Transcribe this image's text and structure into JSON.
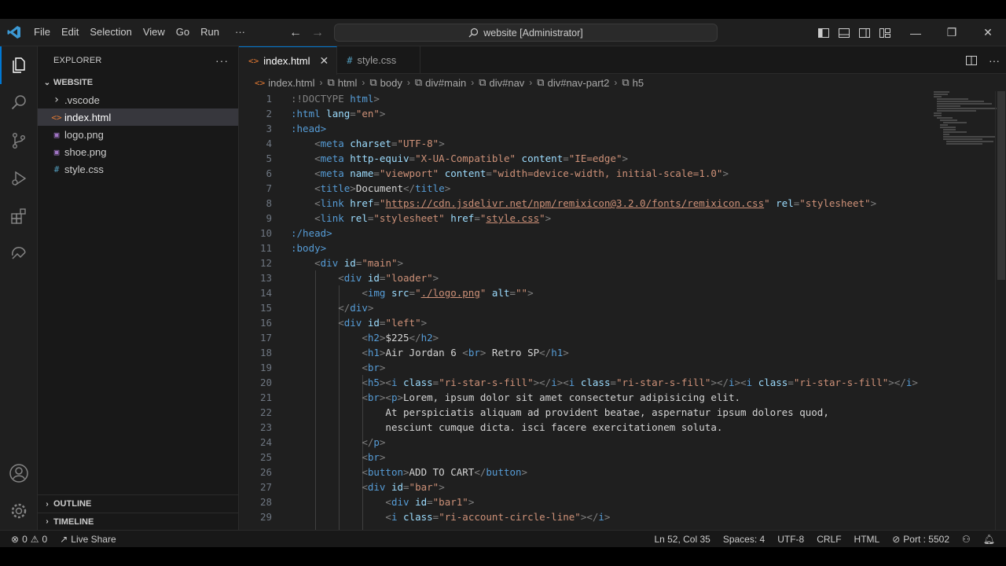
{
  "window": {
    "title": "website [Administrator]",
    "menu": [
      "File",
      "Edit",
      "Selection",
      "View",
      "Go",
      "Run"
    ],
    "menu_more": "···"
  },
  "sidebar": {
    "header": "EXPLORER",
    "more": "···",
    "folder": "WEBSITE",
    "items": [
      {
        "name": ".vscode",
        "icon": "chevron-right-icon",
        "glyph": "›"
      },
      {
        "name": "index.html",
        "icon": "html-file-icon",
        "glyph": "<>"
      },
      {
        "name": "logo.png",
        "icon": "image-file-icon",
        "glyph": "▣"
      },
      {
        "name": "shoe.png",
        "icon": "image-file-icon",
        "glyph": "▣"
      },
      {
        "name": "style.css",
        "icon": "css-file-icon",
        "glyph": "#"
      }
    ],
    "outline": "OUTLINE",
    "timeline": "TIMELINE"
  },
  "tabs": [
    {
      "label": "index.html",
      "glyph": "<>",
      "active": true,
      "close": "✕"
    },
    {
      "label": "style.css",
      "glyph": "#",
      "active": false
    }
  ],
  "breadcrumb": [
    "index.html",
    "html",
    "body",
    "div#main",
    "div#nav",
    "div#nav-part2",
    "h5"
  ],
  "code": {
    "line_numbers": [
      "1",
      "2",
      "3",
      "4",
      "5",
      "6",
      "7",
      "8",
      "9",
      "10",
      "11",
      "12",
      "13",
      "14",
      "15",
      "16",
      "17",
      "18",
      "19",
      "20",
      "21",
      "22",
      "23",
      "24",
      "25",
      "26",
      "27",
      "28",
      "29"
    ],
    "l1_a": ":!DOCTYPE",
    "l1_b": "html",
    "l1_c": ">",
    "l2_a": ":html",
    "l2_attr": "lang",
    "l2_val": "\"en\"",
    "l2_c": ">",
    "l3_a": ":head>",
    "l4_tag": "meta",
    "l4_attr": "charset",
    "l4_val": "\"UTF-8\"",
    "l5_tag": "meta",
    "l5_attr1": "http-equiv",
    "l5_val1": "\"X-UA-Compatible\"",
    "l5_attr2": "content",
    "l5_val2": "\"IE=edge\"",
    "l6_tag": "meta",
    "l6_attr1": "name",
    "l6_val1": "\"viewport\"",
    "l6_attr2": "content",
    "l6_val2": "\"width=device-width, initial-scale=1.0\"",
    "l7_tag": "title",
    "l7_text": "Document",
    "l7_close": "title",
    "l8_tag": "link",
    "l8_attr1": "href",
    "l8_q1": "\"",
    "l8_url": "https://cdn.jsdelivr.net/npm/remixicon@3.2.0/fonts/remixicon.css",
    "l8_q2": "\"",
    "l8_attr2": "rel",
    "l8_val2": "\"stylesheet\"",
    "l9_tag": "link",
    "l9_attr1": "rel",
    "l9_val1": "\"stylesheet\"",
    "l9_attr2": "href",
    "l9_q1": "\"",
    "l9_url": "style.css",
    "l9_q2": "\"",
    "l10": ":/head>",
    "l11": ":body>",
    "l12_tag": "div",
    "l12_attr": "id",
    "l12_val": "\"main\"",
    "l13_tag": "div",
    "l13_attr": "id",
    "l13_val": "\"loader\"",
    "l14_tag": "img",
    "l14_attr1": "src",
    "l14_q1": "\"",
    "l14_url": "./logo.png",
    "l14_q2": "\"",
    "l14_attr2": "alt",
    "l14_val2": "\"\"",
    "l15_close": "div",
    "l16_tag": "div",
    "l16_attr": "id",
    "l16_val": "\"left\"",
    "l17_tag": "h2",
    "l17_text": "$225",
    "l17_close": "h2",
    "l18_tag": "h1",
    "l18_text1": "Air Jordan 6 ",
    "l18_br": "br",
    "l18_text2": " Retro SP",
    "l18_close": "h1",
    "l19_tag": "br",
    "l20_h5": "h5",
    "l20_i": "i",
    "l20_attr": "class",
    "l20_val": "\"ri-star-s-fill\"",
    "l20_iclose": "i",
    "l21_br": "br",
    "l21_p": "p",
    "l21_text": "Lorem, ipsum dolor sit amet consectetur adipisicing elit.",
    "l22_text": "At perspiciatis aliquam ad provident beatae, aspernatur ipsum dolores quod,",
    "l23_text": "nesciunt cumque dicta. isci facere exercitationem soluta.",
    "l24_close": "p",
    "l25_tag": "br",
    "l26_tag": "button",
    "l26_text": "ADD TO CART",
    "l26_close": "button",
    "l27_tag": "div",
    "l27_attr": "id",
    "l27_val": "\"bar\"",
    "l28_tag": "div",
    "l28_attr": "id",
    "l28_val": "\"bar1\"",
    "l29_tag": "i",
    "l29_attr": "class",
    "l29_val": "\"ri-account-circle-line\"",
    "l29_close": "i"
  },
  "statusbar": {
    "errors": "0",
    "warnings": "0",
    "live_share": "Live Share",
    "position": "Ln 52, Col 35",
    "spaces": "Spaces: 4",
    "encoding": "UTF-8",
    "eol": "CRLF",
    "language": "HTML",
    "port": "Port : 5502"
  },
  "colors": {
    "accent": "#0078d4",
    "editor_bg": "#1f1f1f",
    "sidebar_bg": "#181818",
    "tag": "#569cd6",
    "attribute": "#9cdcfe",
    "string": "#ce9178"
  }
}
